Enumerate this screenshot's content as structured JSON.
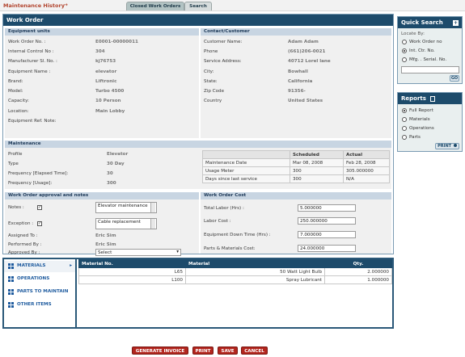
{
  "app": {
    "title": "Maintenance History",
    "title_arrow": "→"
  },
  "tabs": [
    {
      "label": "Closed Work Orders"
    },
    {
      "label": "Search"
    }
  ],
  "work_order": {
    "header": "Work Order",
    "equipment": {
      "section_title": "Equipment units",
      "fields": [
        {
          "label": "Work Order No. :",
          "value": "E0001-00000011"
        },
        {
          "label": "Internal Control No :",
          "value": "304"
        },
        {
          "label": "Manufacturer Sl. No. :",
          "value": "kj76753"
        },
        {
          "label": "Equipment Name :",
          "value": "elevator"
        },
        {
          "label": "Brand:",
          "value": "Liftronic"
        },
        {
          "label": "Model:",
          "value": "Turbo 4500"
        },
        {
          "label": "Capacity:",
          "value": "10 Person"
        },
        {
          "label": "Location:",
          "value": "Main Lobby"
        },
        {
          "label": "Equipment Ref. Note:",
          "value": ""
        }
      ]
    },
    "contact": {
      "section_title": "Contact/Customer",
      "fields": [
        {
          "label": "Customer Name:",
          "value": "Adam Adam"
        },
        {
          "label": "Phone",
          "value": "(661)206-0021"
        },
        {
          "label": "Service Address:",
          "value": "40712 Lorel lane"
        },
        {
          "label": "City:",
          "value": "Bowhall"
        },
        {
          "label": "State:",
          "value": "California"
        },
        {
          "label": "Zip Code",
          "value": "91356-"
        },
        {
          "label": "Country",
          "value": "United States"
        }
      ]
    },
    "maintenance": {
      "section_title": "Maintenance",
      "fields": [
        {
          "label": "Profile",
          "value": "Elevator"
        },
        {
          "label": "Type",
          "value": "30 Day"
        },
        {
          "label": "Frequency [Elapsed Time]:",
          "value": "30"
        },
        {
          "label": "Frequency [Usage]:",
          "value": "300"
        }
      ],
      "schedule_table": {
        "headers": [
          "",
          "Scheduled",
          "Actual"
        ],
        "rows": [
          [
            "Maintenance Date",
            "Mar 08, 2008",
            "Feb 28, 2008"
          ],
          [
            "Usage Meter",
            "300",
            "305.000000"
          ],
          [
            "Days since last service",
            "300",
            "N/A"
          ]
        ]
      }
    },
    "approval": {
      "section_title": "Work Order approval and notes",
      "notes_label": "Notes :",
      "notes_value": "Elevator maintenance",
      "exception_label": "Exception :",
      "exception_value": "Cable replacement",
      "assigned_label": "Assigned To :",
      "assigned_value": "Eric Sim",
      "performed_label": "Performed By :",
      "performed_value": "Eric Sim",
      "approved_label": "Approved By :",
      "approved_value": "Select"
    },
    "cost": {
      "section_title": "Work Order Cost",
      "fields": [
        {
          "label": "Total Labor (Hrs) :",
          "value": "5.000000"
        },
        {
          "label": "Labor Cost :",
          "value": "250.000000"
        },
        {
          "label": "Equipment Down Time (Hrs) :",
          "value": "7.000000"
        },
        {
          "label": "Parts & Materials Cost:",
          "value": "24.000000"
        }
      ]
    }
  },
  "quick_search": {
    "title": "Quick Search",
    "locate_label": "Locate By:",
    "options": [
      "Work Order no",
      "Int. Ctr. No.",
      "Mfg. . Serial. No."
    ],
    "selected": 1,
    "go_label": "GO"
  },
  "reports": {
    "title": "Reports",
    "options": [
      "Full Report",
      "Materials",
      "Operations",
      "Parts"
    ],
    "selected": 0,
    "print_label": "PRINT"
  },
  "materials_menu": [
    {
      "label": "MATERIALS",
      "icon": "grid-icon"
    },
    {
      "label": "OPERATIONS",
      "icon": "grid-icon"
    },
    {
      "label": "PARTS TO MAINTAIN",
      "icon": "grid-icon"
    },
    {
      "label": "OTHER ITEMS",
      "icon": "grid-icon"
    }
  ],
  "materials_table": {
    "headers": [
      "Material No.",
      "Material",
      "Qty."
    ],
    "rows": [
      [
        "L65",
        "50 Watt Light Bulb",
        "2.000000"
      ],
      [
        "L100",
        "Spray Lubricant",
        "1.000000"
      ]
    ]
  },
  "footer_buttons": [
    "GENERATE INVOICE",
    "PRINT",
    "SAVE",
    "CANCEL"
  ],
  "colors": {
    "header_dark": "#1d4b6b",
    "section_light": "#c8d5e2",
    "button_red": "#b3261e",
    "title_red": "#b1442d"
  }
}
